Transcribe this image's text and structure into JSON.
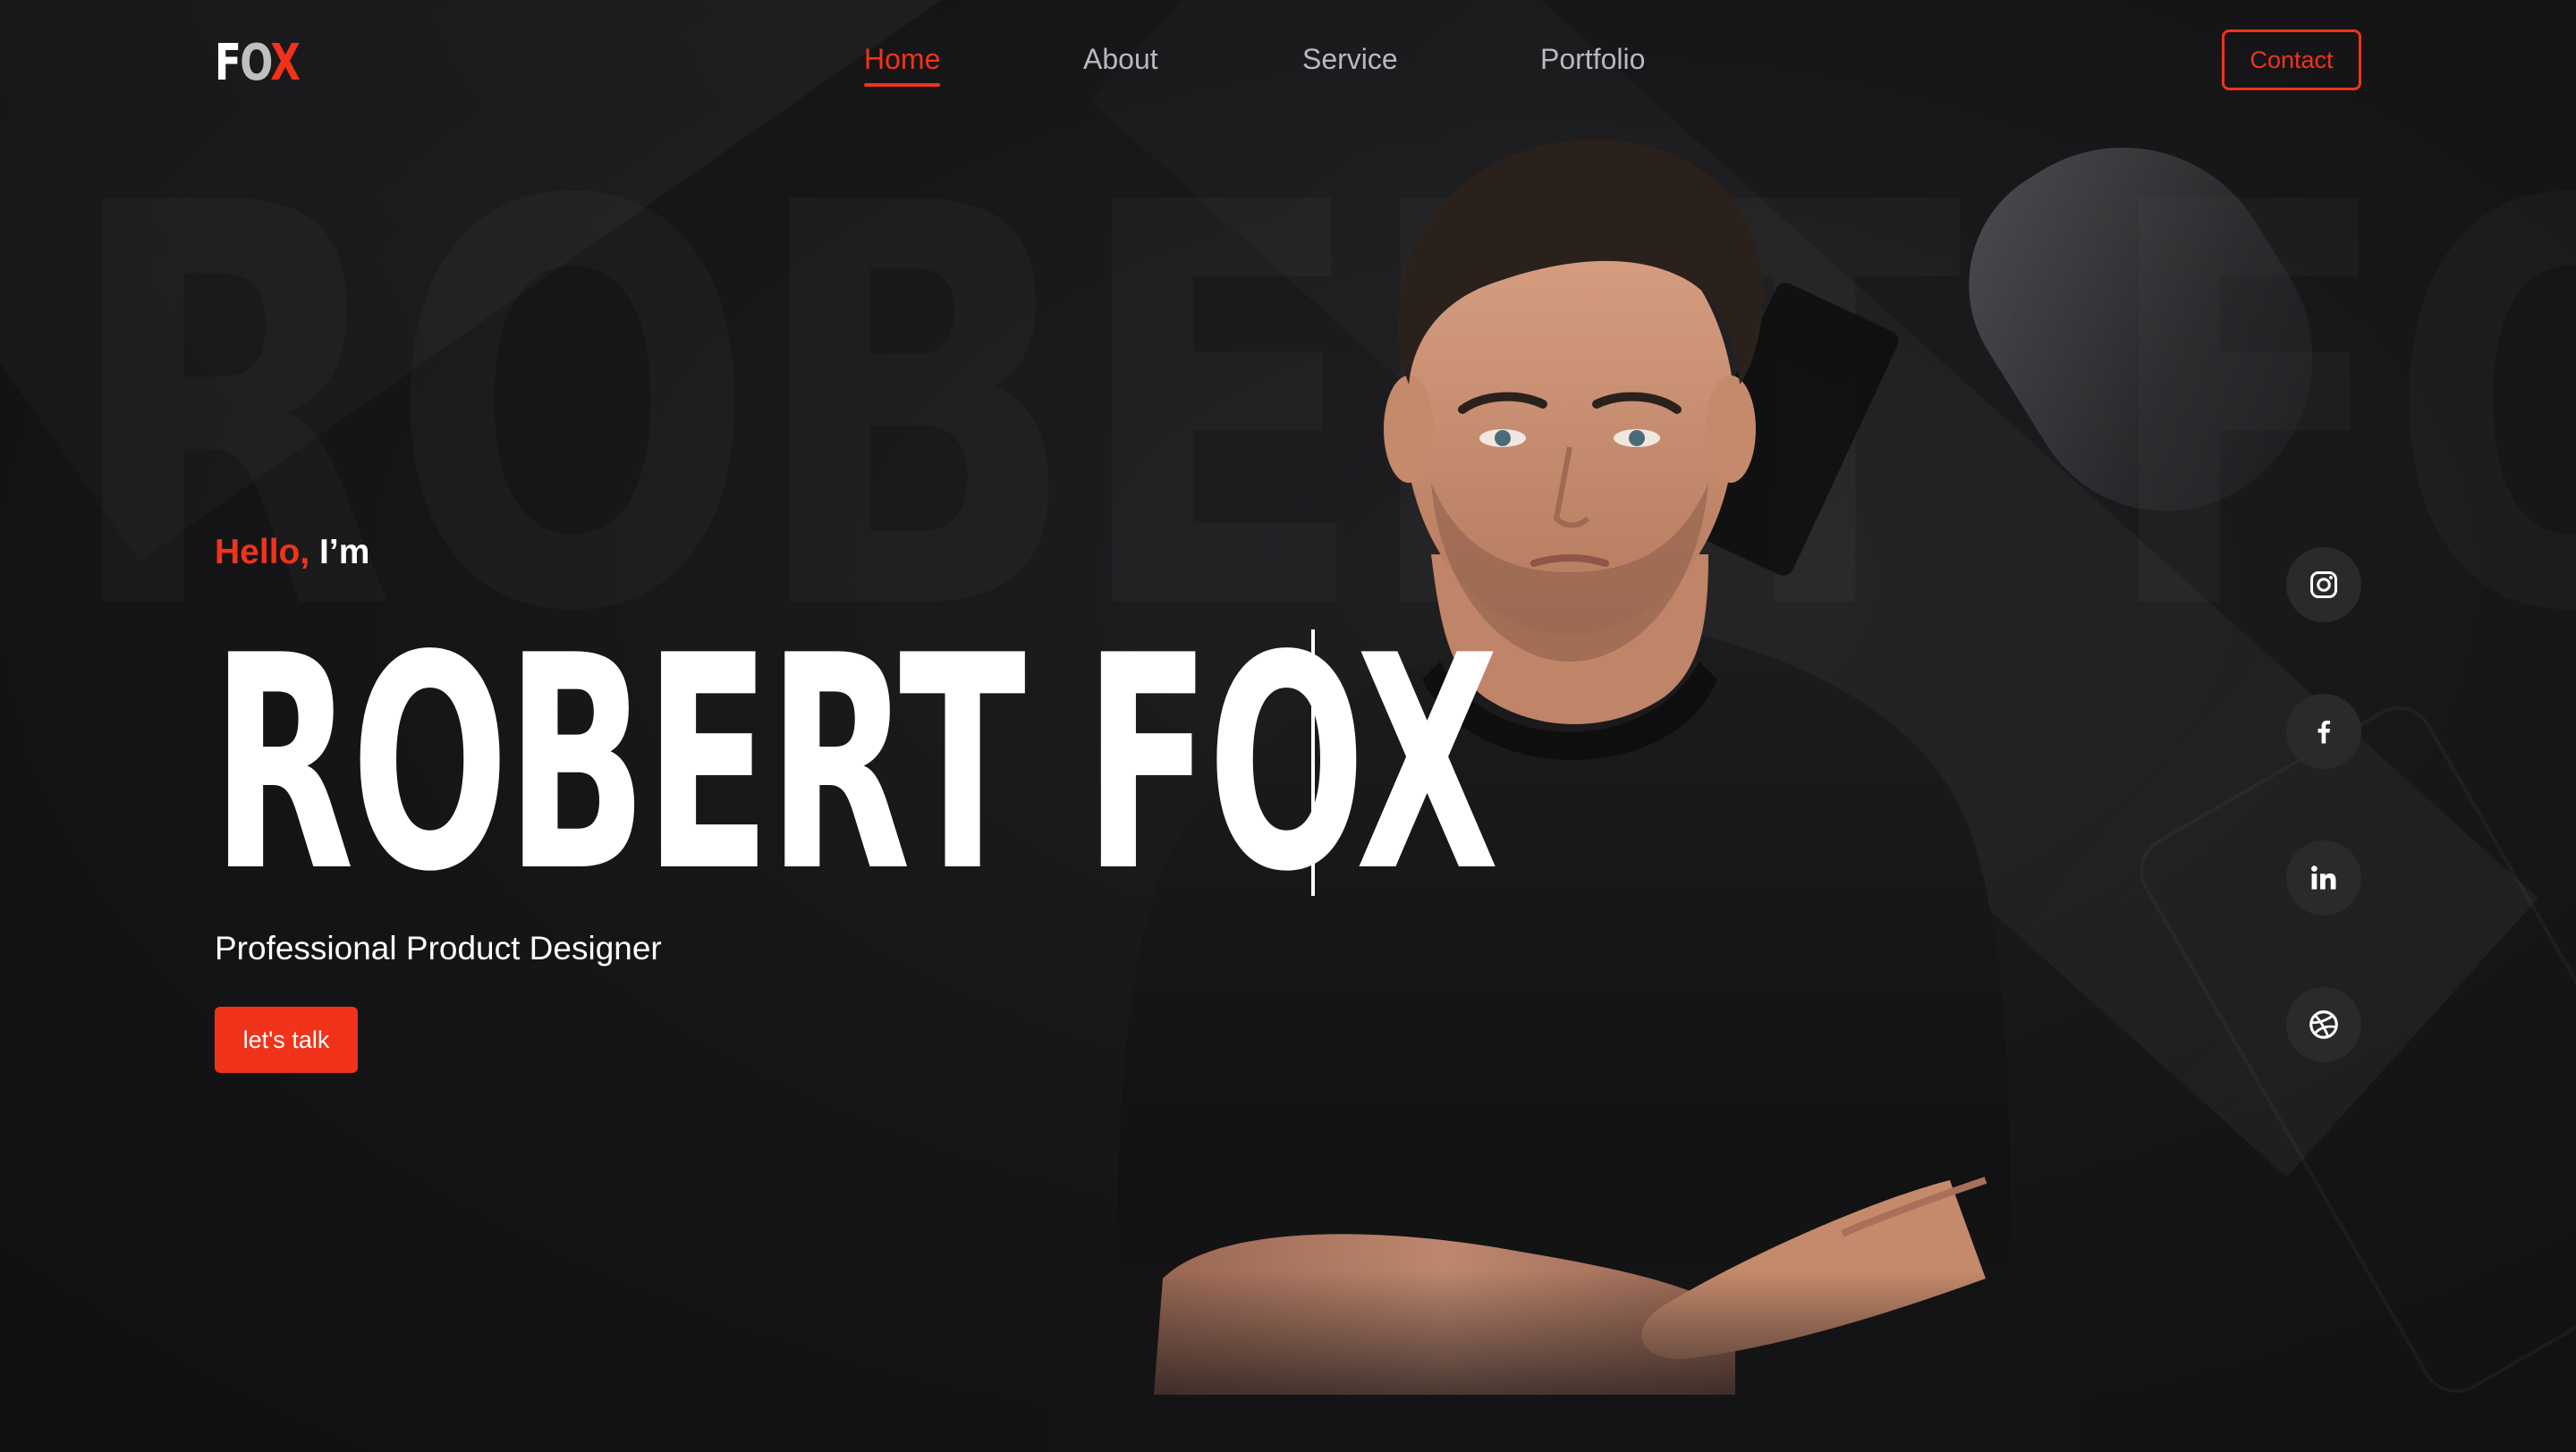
{
  "header": {
    "logo": {
      "f": "F",
      "o": "O",
      "x": "X"
    },
    "nav": [
      {
        "label": "Home",
        "active": true
      },
      {
        "label": "About",
        "active": false
      },
      {
        "label": "Service",
        "active": false
      },
      {
        "label": "Portfolio",
        "active": false
      }
    ],
    "contact_label": "Contact"
  },
  "hero": {
    "greeting_hello": "Hello,",
    "greeting_rest": " I’m",
    "name": "ROBERT FOX",
    "background_text": "ROBERT FOX",
    "subtitle": "Professional Product Designer",
    "cta_label": "let's talk"
  },
  "socials": [
    {
      "icon": "instagram-icon"
    },
    {
      "icon": "facebook-icon"
    },
    {
      "icon": "linkedin-icon"
    },
    {
      "icon": "dribbble-icon"
    }
  ],
  "colors": {
    "accent": "#f0331a",
    "background": "#141416",
    "text": "#ffffff",
    "muted": "#b9b9bd"
  }
}
